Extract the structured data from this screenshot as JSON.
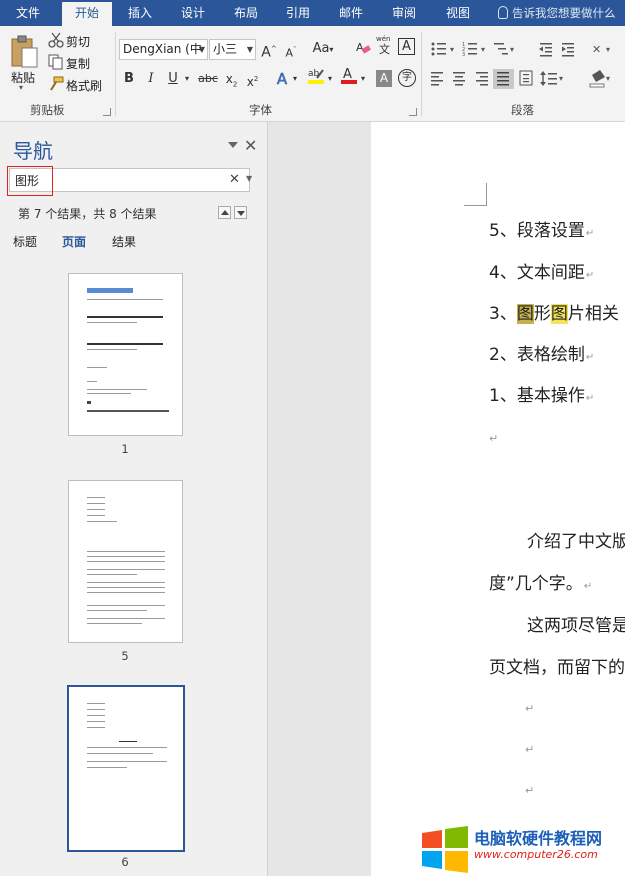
{
  "tabs": [
    "文件",
    "开始",
    "插入",
    "设计",
    "布局",
    "引用",
    "邮件",
    "审阅",
    "视图"
  ],
  "tell_me": "告诉我您想要做什么",
  "clipboard": {
    "paste": "粘贴",
    "cut": "剪切",
    "copy": "复制",
    "format_painter": "格式刷",
    "label": "剪贴板"
  },
  "font": {
    "name": "DengXian (中",
    "size": "小三",
    "label": "字体",
    "change_case": "Aa",
    "phonetic": "wén"
  },
  "paragraph": {
    "label": "段落"
  },
  "nav": {
    "title": "导航",
    "search_value": "图形",
    "result_count": "第 7 个结果，共 8 个结果",
    "tab_headings": "标题",
    "tab_pages": "页面",
    "tab_results": "结果",
    "pages": [
      "1",
      "5",
      "6"
    ]
  },
  "doc": {
    "lines": [
      "5、段落设置",
      "4、文本间距",
      "2、表格绘制",
      "1、基本操作"
    ],
    "line3_prefix": "3、",
    "line3_hit1": "图",
    "line3_mid": "形",
    "line3_hit2": "图",
    "line3_rest": "片相关",
    "para1_a": "介绍了中文版",
    "para1_b": "度”几个字。",
    "para2_a": "这两项尽管是",
    "para2_b": "页文档，而留下的"
  },
  "watermark": {
    "title": "电脑软硬件教程网",
    "url": "www.computer26.com"
  },
  "colors": {
    "accent": "#2b579a",
    "search_highlight_border": "#e0201a",
    "hit_current": "#c8b04a",
    "hit_other": "#f4e35a"
  }
}
